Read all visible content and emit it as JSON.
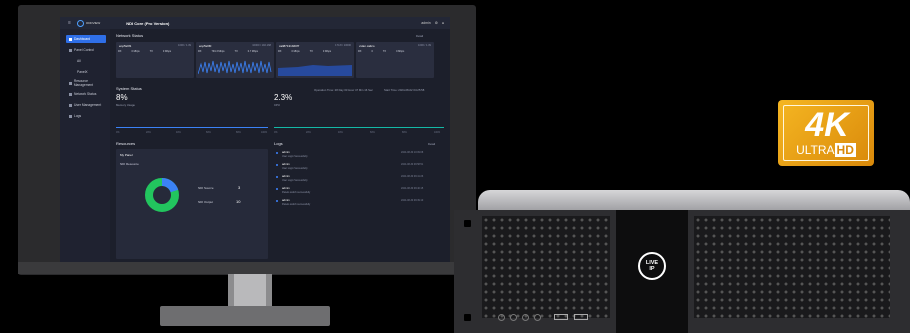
{
  "app": {
    "brand": "ODDVIEW",
    "title": "NDI Core (Pro Version)",
    "user": "admin"
  },
  "sidebar": {
    "items": [
      {
        "label": "Dashboard"
      },
      {
        "label": "Panel Control"
      },
      {
        "label": "All"
      },
      {
        "label": "PanelX"
      },
      {
        "label": "Resource Management"
      },
      {
        "label": "Network Status"
      },
      {
        "label": "User Management"
      },
      {
        "label": "Logs"
      }
    ]
  },
  "network": {
    "title": "Network Status",
    "more": "Detail",
    "cards": [
      {
        "name": "enp5s0f1",
        "info": "1000 / 1.39",
        "rx": "RX",
        "rx_val": "0 Mbps",
        "tx": "TX",
        "tx_val": "0 Mbps"
      },
      {
        "name": "enp5s0f0",
        "info": "10000 / 192.168",
        "rx": "RX",
        "rx_val": "794.3 Mbps",
        "tx": "TX",
        "tx_val": "0.7 Mbps"
      },
      {
        "name": "cali87131b60f7",
        "info": "174.8 / 10000",
        "rx": "RX",
        "rx_val": "0 Mbps",
        "tx": "TX",
        "tx_val": "0 Mbps"
      },
      {
        "name": "vxlan.calico",
        "info": "1000 / 1.39",
        "rx": "RX",
        "rx_val": "0",
        "tx": "TX",
        "tx_val": "0 Mbps"
      }
    ]
  },
  "system": {
    "title": "System Status",
    "memory_value": "8%",
    "memory_label": "Memory Usage",
    "cpu_value": "2.3%",
    "cpu_label": "CPU",
    "uptime": "Operation Time: 28 Day 03 Hour 47 Min 16 Sec",
    "start": "Start Time: 2024-08-02 04:25:58",
    "mem_axis": [
      "0%",
      "20%",
      "40%",
      "60%",
      "80%",
      "100%"
    ],
    "cpu_axis": [
      "0%",
      "20%",
      "40%",
      "60%",
      "80%",
      "100%"
    ]
  },
  "resources": {
    "title": "Resources",
    "panel_name": "My Panel",
    "section": "NDI Resource",
    "source_label": "NDI Source",
    "source_count": "3",
    "output_label": "NDI Output",
    "output_count": "10"
  },
  "logs": {
    "title": "Logs",
    "more": "Detail",
    "entries": [
      {
        "user": "admin",
        "msg": "User Login Successfully",
        "time": "2024-08-30 10:09:08"
      },
      {
        "user": "admin",
        "msg": "User Login Successfully",
        "time": "2024-08-30 09:58:51"
      },
      {
        "user": "admin",
        "msg": "User Login Successfully",
        "time": "2024-08-30 09:41:26"
      },
      {
        "user": "admin",
        "msg": "Panels switch successfully",
        "time": "2024-08-30 09:40:15"
      },
      {
        "user": "admin",
        "msg": "Panels switch successfully",
        "time": "2024-08-30 09:39:10"
      }
    ]
  },
  "badge": {
    "top": "4K",
    "ultra": "ULTRA",
    "hd": "HD"
  },
  "device": {
    "logo_line1": "LIVE",
    "logo_line2": "IP"
  },
  "colors": {
    "accent": "#2f6fe8",
    "donut_green": "#22c55e",
    "donut_blue": "#3b82f6",
    "badge_orange": "#f0a81a"
  }
}
